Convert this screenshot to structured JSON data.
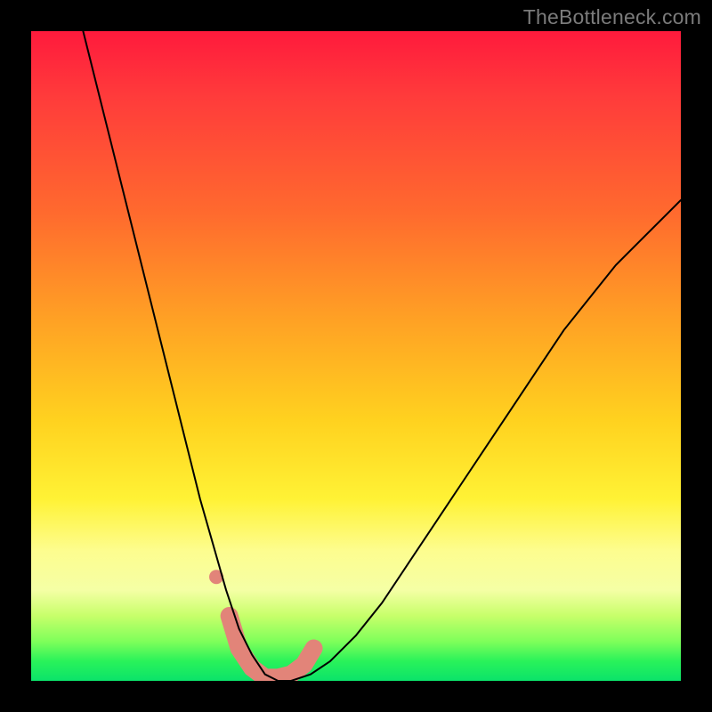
{
  "watermark": "TheBottleneck.com",
  "chart_data": {
    "type": "line",
    "title": "",
    "xlabel": "",
    "ylabel": "",
    "xlim": [
      0,
      100
    ],
    "ylim": [
      0,
      100
    ],
    "grid": false,
    "legend": false,
    "annotations": [],
    "background": {
      "style": "vertical-gradient",
      "stops": [
        {
          "pos": 0,
          "color": "#ff1a3c"
        },
        {
          "pos": 28,
          "color": "#ff6a2e"
        },
        {
          "pos": 60,
          "color": "#ffd21f"
        },
        {
          "pos": 80,
          "color": "#fdfd8f"
        },
        {
          "pos": 94,
          "color": "#7dff5a"
        },
        {
          "pos": 100,
          "color": "#0be36a"
        }
      ]
    },
    "series": [
      {
        "name": "bottleneck-curve",
        "color": "#000000",
        "width": 2,
        "x": [
          8,
          10,
          12,
          14,
          16,
          18,
          20,
          22,
          24,
          26,
          28,
          30,
          32,
          34,
          36,
          38,
          40,
          43,
          46,
          50,
          54,
          58,
          62,
          66,
          70,
          74,
          78,
          82,
          86,
          90,
          94,
          98,
          100
        ],
        "y": [
          100,
          92,
          84,
          76,
          68,
          60,
          52,
          44,
          36,
          28,
          21,
          14,
          8,
          4,
          1,
          0,
          0,
          1,
          3,
          7,
          12,
          18,
          24,
          30,
          36,
          42,
          48,
          54,
          59,
          64,
          68,
          72,
          74
        ]
      }
    ],
    "markers": [
      {
        "name": "trough-highlight",
        "color": "#e28479",
        "shape": "rounded-track",
        "width": 20,
        "points_x": [
          30.5,
          32,
          34,
          36,
          38,
          40,
          42,
          43.5
        ],
        "points_y": [
          10,
          5,
          2,
          0.5,
          0.5,
          1,
          2.5,
          5
        ]
      },
      {
        "name": "left-dot",
        "color": "#e28479",
        "shape": "circle",
        "radius": 8,
        "x": 28.5,
        "y": 16
      }
    ]
  }
}
